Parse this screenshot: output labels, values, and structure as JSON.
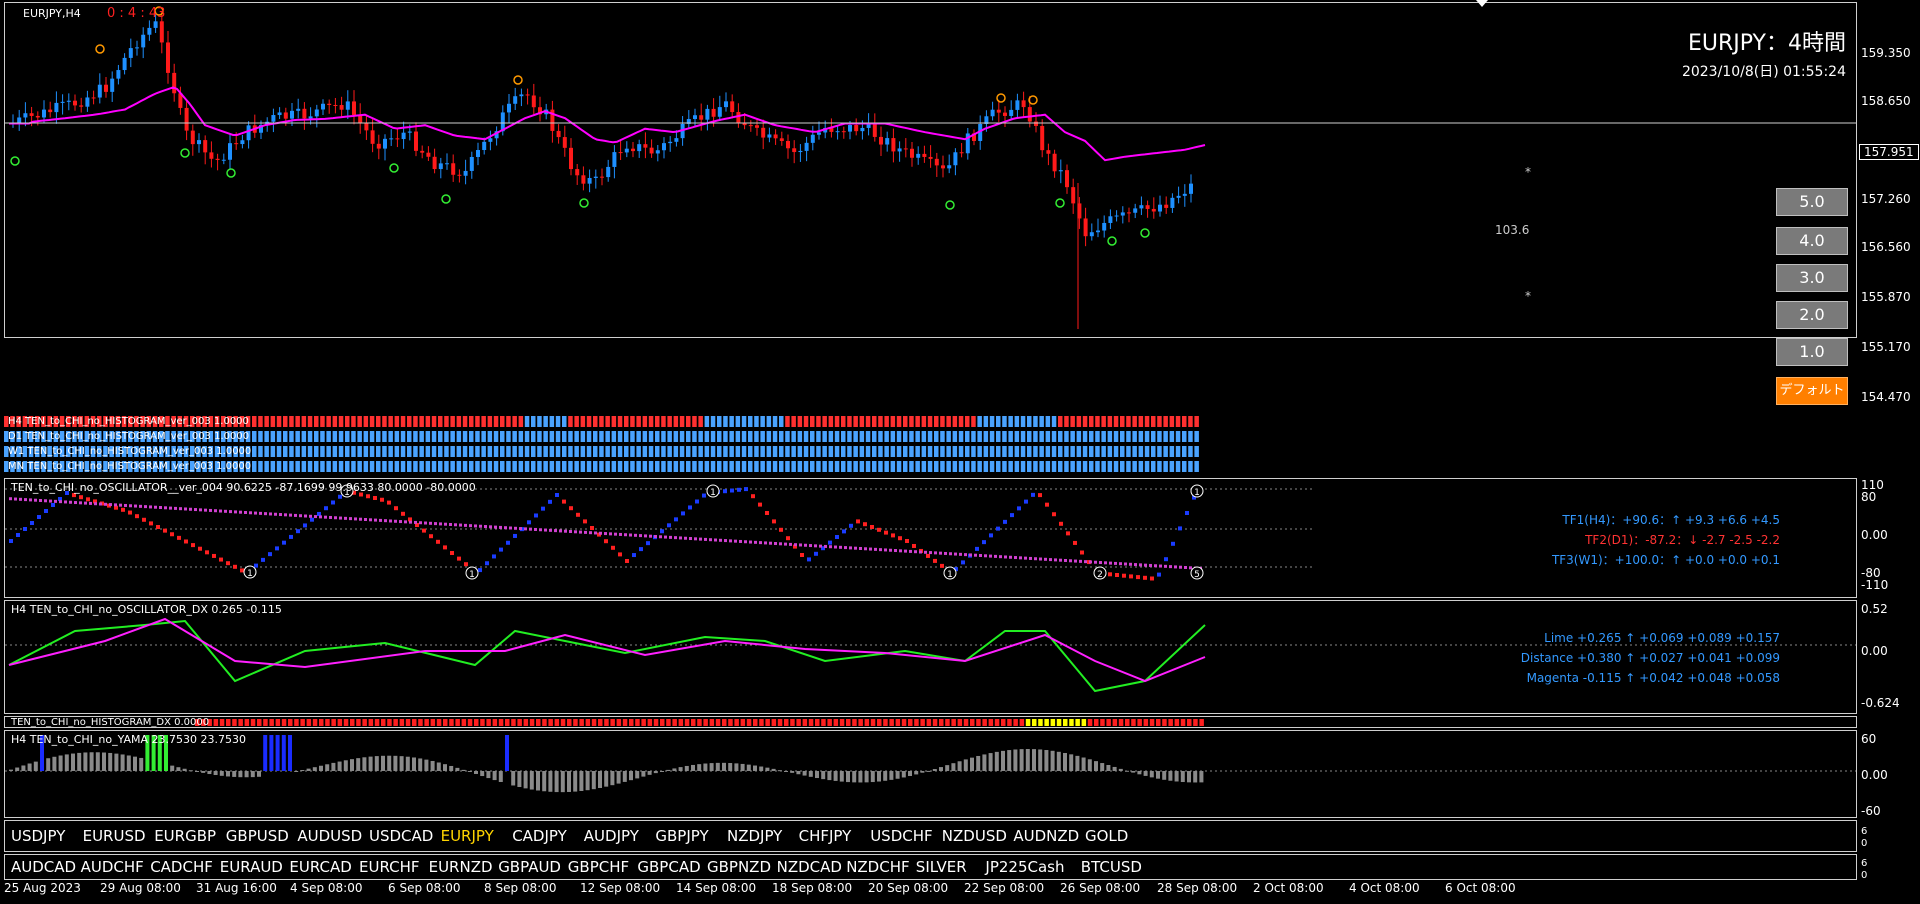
{
  "chart": {
    "symbol_tf": "EURJPY,H4",
    "countdown": "0 : 4 : 43",
    "big_title": "EURJPY：4時間",
    "datetime": "2023/10/8(日) 01:55:24",
    "current_price": "157.951",
    "side_value": "103.6",
    "price_ticks": [
      "159.350",
      "158.650",
      "157.260",
      "156.560",
      "155.870",
      "155.170",
      "154.470"
    ]
  },
  "zoom_buttons": [
    "5.0",
    "4.0",
    "3.0",
    "2.0",
    "1.0"
  ],
  "default_button": "デフォルト",
  "histogram_rows": [
    "H4 TEN_to_CHI_no_HISTOGRAM_ver_003 1.0000",
    "D1 TEN_to_CHI_no_HISTOGRAM_ver_003 1.0000",
    "W1 TEN_to_CHI_no_HISTOGRAM_ver_003 1.0000",
    "MN TEN_to_CHI_no_HISTOGRAM_ver_003 1.0000"
  ],
  "oscillator": {
    "title": "TEN_to_CHI_no_OSCILLATOR__ver_004 90.6225 -87.1699 99.9633 80.0000 -80.0000",
    "ticks": [
      "110",
      "80",
      "0.00",
      "-80",
      "-110"
    ],
    "tf1": "TF1(H4)：+90.6：↑ +9.3 +6.6 +4.5",
    "tf2": "TF2(D1)：-87.2：↓ -2.7 -2.5 -2.2",
    "tf3": "TF3(W1)：+100.0：↑ +0.0 +0.0 +0.1"
  },
  "dx": {
    "title": "H4 TEN_to_CHI_no_OSCILLATOR_DX 0.265 -0.115",
    "ticks": [
      "0.52",
      "0.00",
      "-0.624"
    ],
    "lime": "Lime +0.265 ↑ +0.069 +0.089 +0.157",
    "distance": "Distance +0.380 ↑ +0.027 +0.041 +0.099",
    "magenta": "Magenta -0.115 ↑ +0.042 +0.048 +0.058"
  },
  "hist_dx_title": "TEN_to_CHI_no_HISTOGRAM_DX 0.0000",
  "yama": {
    "title": "H4 TEN_to_CHI_no_YAMA 23.7530 23.7530",
    "ticks": [
      "60",
      "0.00",
      "-60"
    ]
  },
  "symbols_row1": [
    "USDJPY",
    "EURUSD",
    "EURGBP",
    "GBPUSD",
    "AUDUSD",
    "USDCAD",
    "EURJPY",
    "CADJPY",
    "AUDJPY",
    "GBPJPY",
    "NZDJPY",
    "CHFJPY",
    "USDCHF",
    "NZDUSD",
    "AUDNZD",
    "GOLD"
  ],
  "symbols_row2": [
    "AUDCAD",
    "AUDCHF",
    "CADCHF",
    "EURAUD",
    "EURCAD",
    "EURCHF",
    "EURNZD",
    "GBPAUD",
    "GBPCHF",
    "GBPCAD",
    "GBPNZD",
    "NZDCAD",
    "NZDCHF",
    "SILVER",
    "JP225Cash",
    "BTCUSD"
  ],
  "active_symbol": "EURJPY",
  "sym_scale": [
    "6",
    "0",
    "6",
    "0"
  ],
  "dates": [
    "25 Aug 2023",
    "29 Aug 08:00",
    "31 Aug 16:00",
    "4 Sep 08:00",
    "6 Sep 08:00",
    "8 Sep 08:00",
    "12 Sep 08:00",
    "14 Sep 08:00",
    "18 Sep 08:00",
    "20 Sep 08:00",
    "22 Sep 08:00",
    "26 Sep 08:00",
    "28 Sep 08:00",
    "2 Oct 08:00",
    "4 Oct 08:00",
    "6 Oct 08:00"
  ],
  "colors": {
    "up": "#1e90ff",
    "down": "#ff1a1a",
    "magenta": "#ff00ff",
    "lime": "#33ee33",
    "cyan": "#00e5ff",
    "orange": "#ff9900",
    "tf2": "#ff3333",
    "tf_blue": "#3399ff"
  }
}
